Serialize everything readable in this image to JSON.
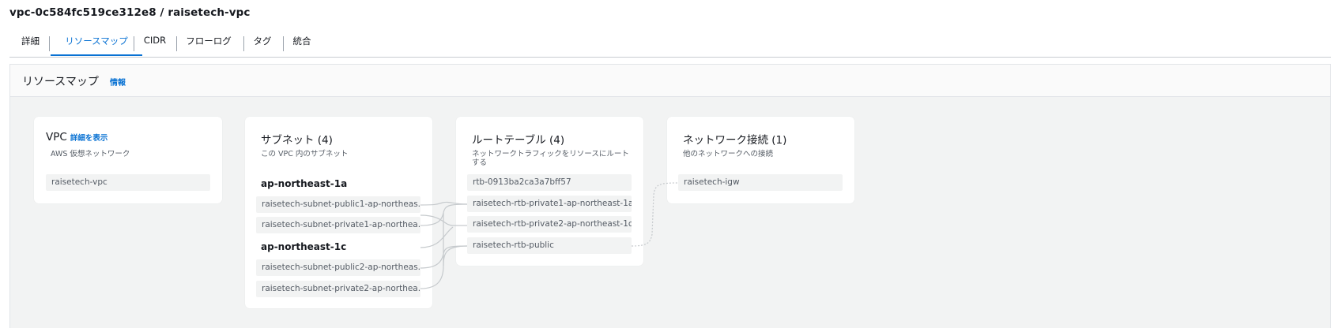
{
  "header": {
    "title": "vpc-0c584fc519ce312e8 / raisetech-vpc"
  },
  "tabs": [
    {
      "label": "詳細"
    },
    {
      "label": "リソースマップ"
    },
    {
      "label": "CIDR"
    },
    {
      "label": "フローログ"
    },
    {
      "label": "タグ"
    },
    {
      "label": "統合"
    }
  ],
  "active_tab": "リソースマップ",
  "panel": {
    "title": "リソースマップ",
    "info": "情報"
  },
  "vpc_card": {
    "title": "VPC",
    "link": "詳細を表示",
    "desc": "AWS 仮想ネットワーク",
    "item": "raisetech-vpc"
  },
  "subnet_card": {
    "title": "サブネット (4)",
    "desc": "この VPC 内のサブネット",
    "groups": [
      {
        "label": "ap-northeast-1a",
        "items": [
          "raisetech-subnet-public1-ap-northeas...",
          "raisetech-subnet-private1-ap-northea..."
        ]
      },
      {
        "label": "ap-northeast-1c",
        "items": [
          "raisetech-subnet-public2-ap-northeas...",
          "raisetech-subnet-private2-ap-northea..."
        ]
      }
    ]
  },
  "route_card": {
    "title": "ルートテーブル (4)",
    "desc": "ネットワークトラフィックをリソースにルートする",
    "items": [
      "rtb-0913ba2ca3a7bff57",
      "raisetech-rtb-private1-ap-northeast-1a",
      "raisetech-rtb-private2-ap-northeast-1c",
      "raisetech-rtb-public"
    ]
  },
  "network_card": {
    "title": "ネットワーク接続 (1)",
    "desc": "他のネットワークへの接続",
    "items": [
      "raisetech-igw"
    ]
  },
  "colors": {
    "accent": "#0972d3",
    "connector": "#c6cacd",
    "item_bg": "#f2f3f3"
  }
}
